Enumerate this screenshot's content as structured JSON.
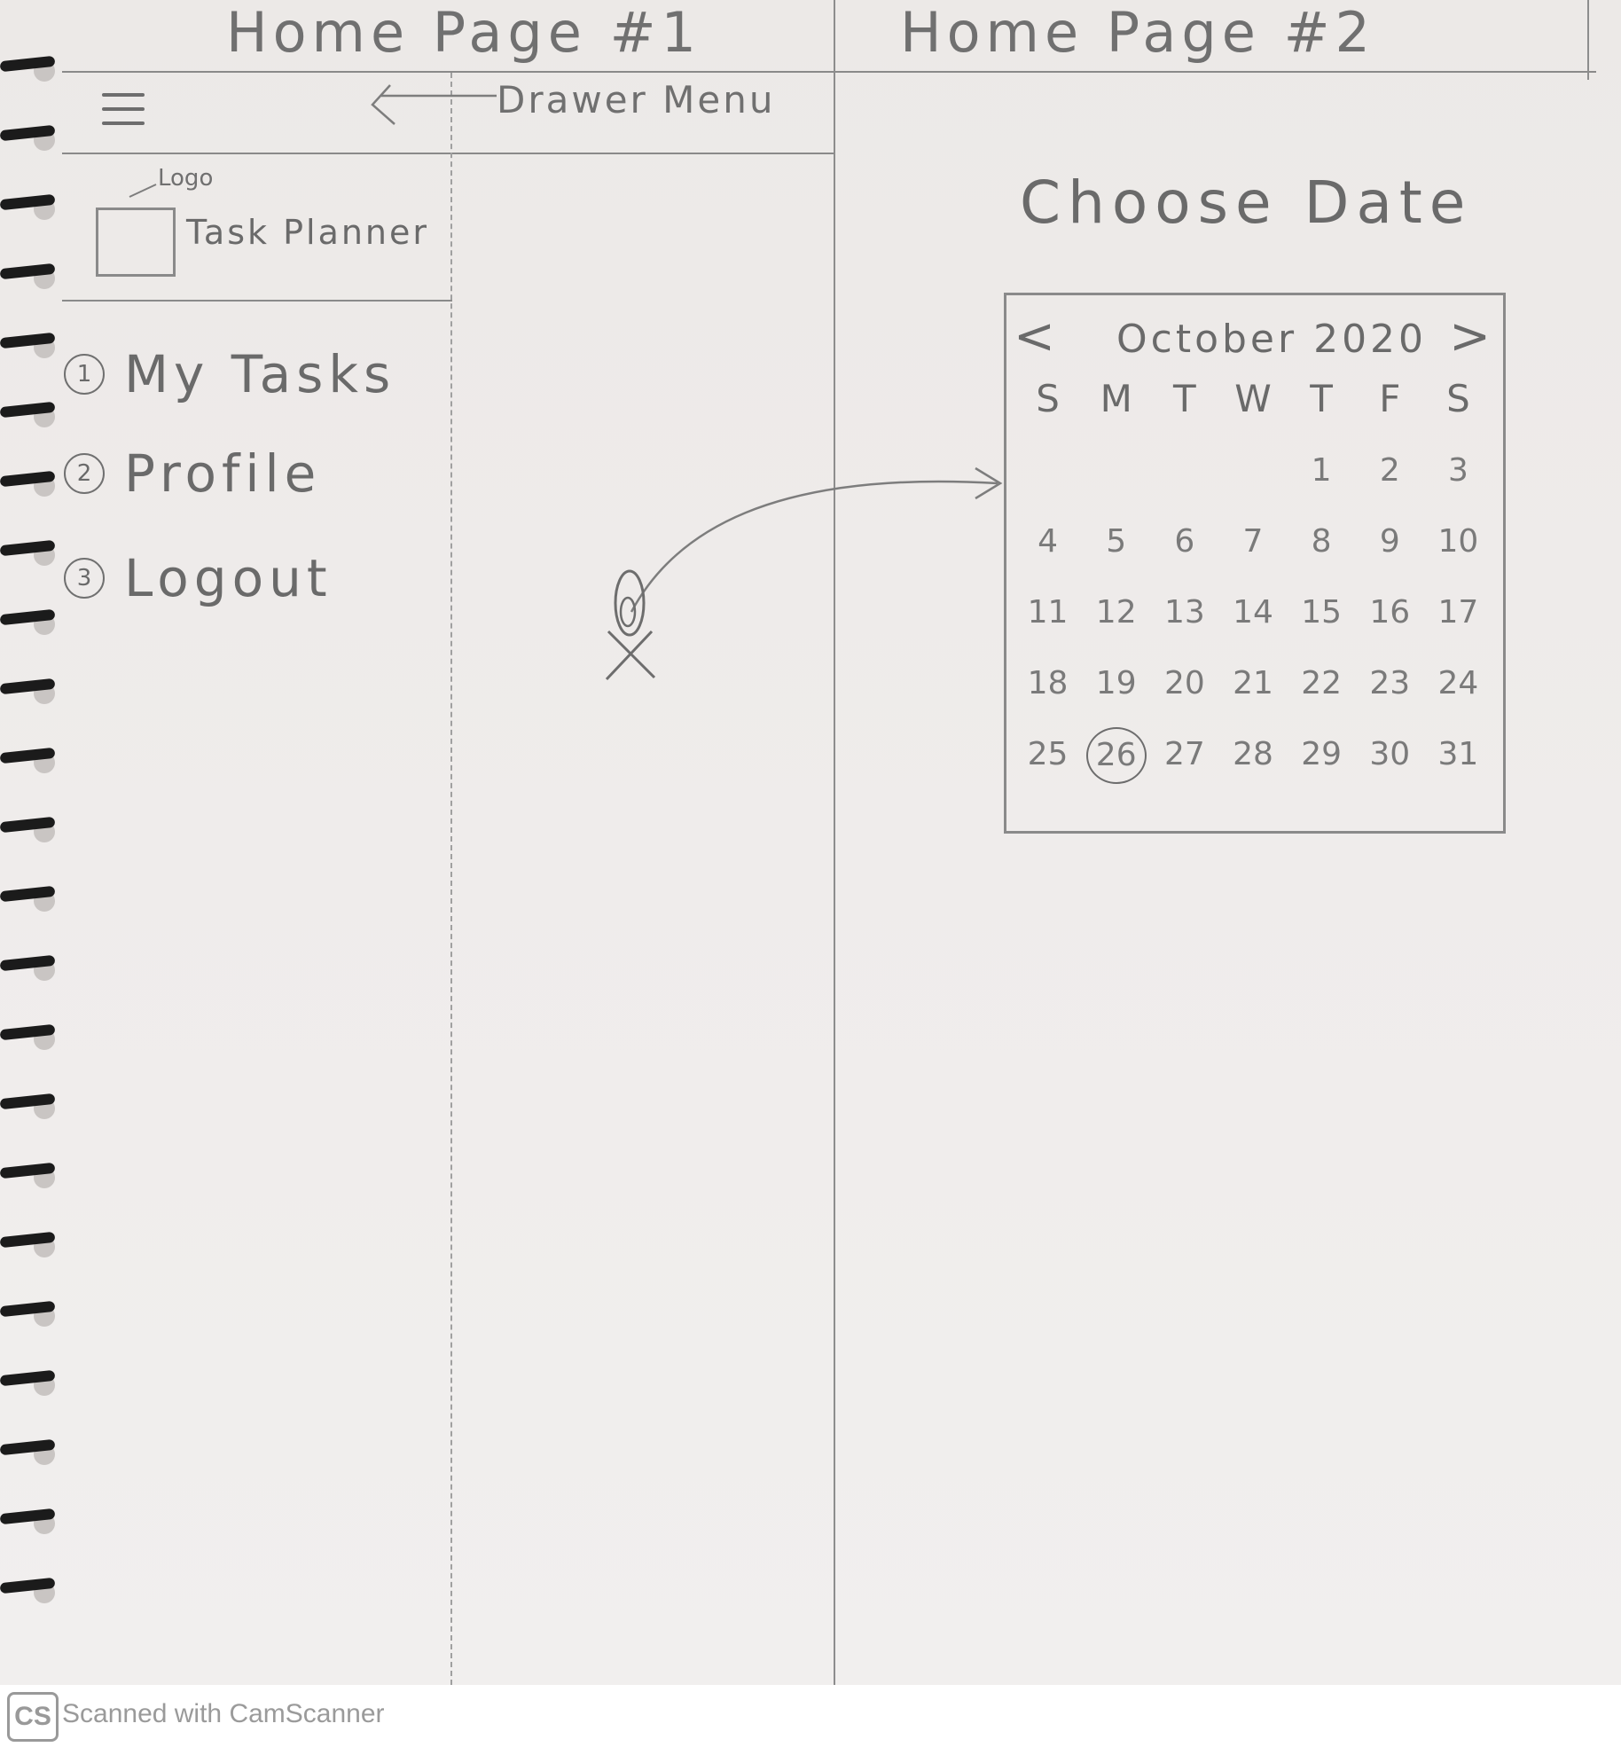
{
  "page1": {
    "title": "Home Page #1",
    "annotation": "Drawer Menu",
    "logo_label": "Logo",
    "brand": "Task Planner",
    "nav": [
      {
        "num": "1",
        "label": "My Tasks"
      },
      {
        "num": "2",
        "label": "Profile"
      },
      {
        "num": "3",
        "label": "Logout"
      }
    ]
  },
  "page2": {
    "title": "Home Page #2",
    "heading": "Choose Date",
    "calendar": {
      "month": "October 2020",
      "prev": "<",
      "next": ">",
      "weekdays": [
        "S",
        "M",
        "T",
        "W",
        "T",
        "F",
        "S"
      ],
      "weeks": [
        [
          "",
          "",
          "",
          "",
          "1",
          "2",
          "3"
        ],
        [
          "4",
          "5",
          "6",
          "7",
          "8",
          "9",
          "10"
        ],
        [
          "11",
          "12",
          "13",
          "14",
          "15",
          "16",
          "17"
        ],
        [
          "18",
          "19",
          "20",
          "21",
          "22",
          "23",
          "24"
        ],
        [
          "25",
          "26",
          "27",
          "28",
          "29",
          "30",
          "31"
        ]
      ],
      "selected": "26"
    }
  },
  "footer": {
    "logo": "CS",
    "text": "Scanned with CamScanner"
  }
}
